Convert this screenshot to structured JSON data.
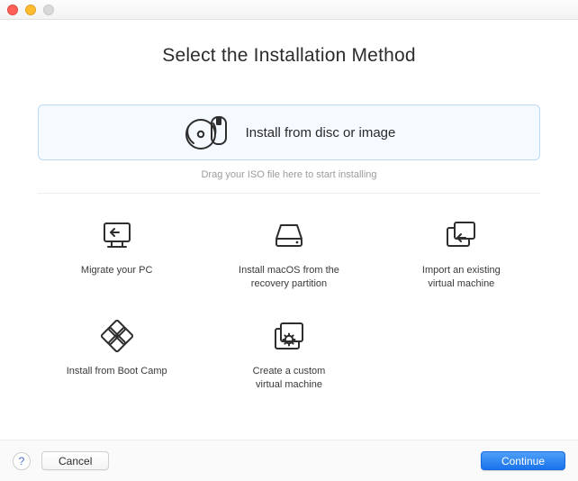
{
  "window": {
    "title": ""
  },
  "page_title": "Select the Installation Method",
  "hero": {
    "label": "Install from disc or image",
    "hint": "Drag your ISO file here to start installing"
  },
  "options": {
    "migrate_pc": {
      "label": "Migrate your PC"
    },
    "install_macos": {
      "label": "Install macOS from the\nrecovery partition"
    },
    "import_vm": {
      "label": "Import an existing\nvirtual machine"
    },
    "bootcamp": {
      "label": "Install from Boot Camp"
    },
    "custom_vm": {
      "label": "Create a custom\nvirtual machine"
    }
  },
  "footer": {
    "help": "?",
    "cancel": "Cancel",
    "continue": "Continue"
  },
  "colors": {
    "accent": "#1f7bed",
    "hero_bg": "#f4faff",
    "hero_border": "#bcd9f6"
  }
}
